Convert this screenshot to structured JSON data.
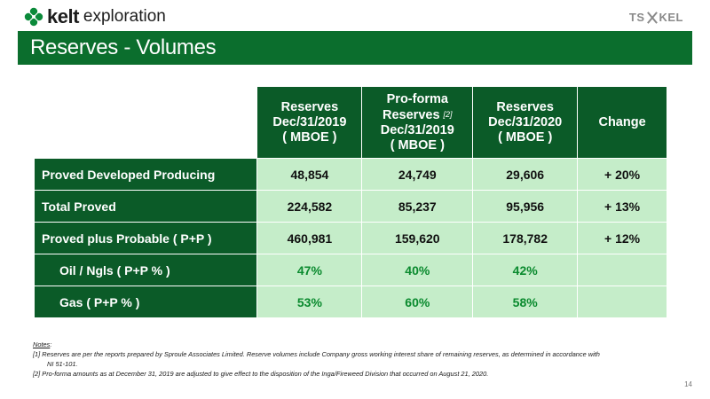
{
  "header": {
    "brand": "kelt",
    "brand_sub": "exploration",
    "exchange_logo": {
      "left": "TS",
      "right": "KEL"
    }
  },
  "title": "Reserves - Volumes",
  "table": {
    "columns": [
      {
        "lines": [
          "Reserves",
          "Dec/31/2019",
          "( MBOE )"
        ]
      },
      {
        "lines": [
          "Pro-forma",
          "Reserves",
          "Dec/31/2019",
          "( MBOE )"
        ],
        "note_ref": "[2]"
      },
      {
        "lines": [
          "Reserves",
          "Dec/31/2020",
          "( MBOE )"
        ]
      },
      {
        "lines": [
          "Change"
        ]
      }
    ],
    "rows": [
      {
        "label": "Proved Developed Producing",
        "values": [
          "48,854",
          "24,749",
          "29,606",
          "+ 20%"
        ]
      },
      {
        "label": "Total  Proved",
        "values": [
          "224,582",
          "85,237",
          "95,956",
          "+ 13%"
        ]
      },
      {
        "label": "Proved plus Probable ( P+P )",
        "values": [
          "460,981",
          "159,620",
          "178,782",
          "+ 12%"
        ]
      },
      {
        "label": "Oil / Ngls ( P+P % )",
        "values": [
          "47%",
          "40%",
          "42%",
          ""
        ]
      },
      {
        "label": "Gas ( P+P % )",
        "values": [
          "53%",
          "60%",
          "58%",
          ""
        ]
      }
    ]
  },
  "notes": {
    "heading": "Notes",
    "note1_a": "[1] Reserves are per the reports prepared by Sproule Associates Limited. Reserve volumes include Company gross working interest share of remaining reserves, as determined in accordance with",
    "note1_b": "NI 51-101.",
    "note2": "[2] Pro-forma amounts as at December 31, 2019 are adjusted to give effect to the disposition of the Inga/Fireweed Division that occurred on August 21, 2020."
  },
  "page_number": "14",
  "colors": {
    "brand_green": "#0b6e2d",
    "header_green": "#0b5b28",
    "cell_green": "#c5edc9",
    "pct_text": "#0a8a2e"
  }
}
